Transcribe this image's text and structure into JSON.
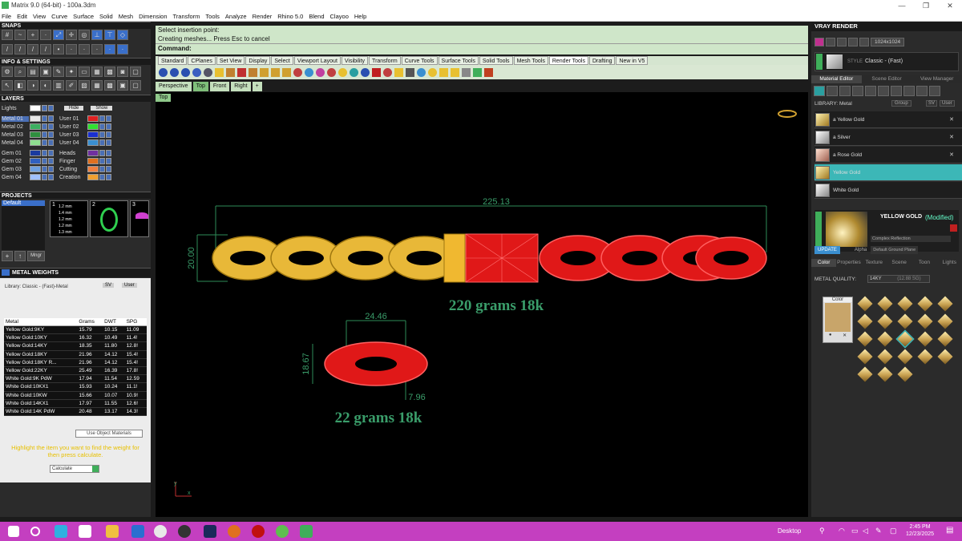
{
  "window": {
    "title": "Matrix 9.0 (64-bit) - 100a.3dm",
    "min": "—",
    "max": "❐",
    "close": "✕"
  },
  "menu": [
    "File",
    "Edit",
    "View",
    "Curve",
    "Surface",
    "Solid",
    "Mesh",
    "Dimension",
    "Transform",
    "Tools",
    "Analyze",
    "Render",
    "Rhino 5.0",
    "Blend",
    "Clayoo",
    "Help"
  ],
  "left": {
    "snaps": "SNAPS",
    "info": "INFO & SETTINGS",
    "layers": "LAYERS",
    "lights": "Lights",
    "hide": "Hide",
    "show": "Show",
    "layer_rows": [
      {
        "a": "Metal 01",
        "ac": "#e8e8e8",
        "b": "User 01",
        "bc": "#e02020"
      },
      {
        "a": "Metal 02",
        "ac": "#3cb060",
        "b": "User 02",
        "bc": "#30e030"
      },
      {
        "a": "Metal 03",
        "ac": "#2f8f3f",
        "b": "User 03",
        "bc": "#1a2fd0"
      },
      {
        "a": "Metal 04",
        "ac": "#8fe090",
        "b": "User 04",
        "bc": "#3a8fd0"
      },
      {
        "a": "Gem 01",
        "ac": "#1a3aa0",
        "b": "Heads",
        "bc": "#7030a0"
      },
      {
        "a": "Gem 02",
        "ac": "#3060c0",
        "b": "Finger",
        "bc": "#e07020"
      },
      {
        "a": "Gem 03",
        "ac": "#6fa0e0",
        "b": "Cutting",
        "bc": "#f08040"
      },
      {
        "a": "Gem 04",
        "ac": "#a0c0ff",
        "b": "Creation",
        "bc": "#f0a030"
      }
    ],
    "projects": "PROJECTS",
    "project_default": "Default",
    "thumb_nums": [
      "1",
      "2",
      "3"
    ],
    "thumb_gems": [
      "1.2 mm",
      "1.4 mm",
      "1.2 mm",
      "1.2 mm",
      "1.3 mm"
    ],
    "mngr": "Mngr",
    "weights_title": "METAL WEIGHTS",
    "library": "Library: Classic - (Fast)-Metal",
    "sv": "SV",
    "user": "User",
    "table_headers": [
      "Metal",
      "Grams",
      "DWT",
      "SPG"
    ],
    "table_rows": [
      [
        "Yellow Gold:9KY",
        "15.79",
        "10.15",
        "11.09"
      ],
      [
        "Yellow Gold:10KY",
        "16.32",
        "10.49",
        "11.4!"
      ],
      [
        "Yellow Gold:14KY",
        "18.35",
        "11.80",
        "12.8!"
      ],
      [
        "Yellow Gold:18KY",
        "21.96",
        "14.12",
        "15.4!"
      ],
      [
        "Yellow Gold:18KY R...",
        "21.96",
        "14.12",
        "15.4!"
      ],
      [
        "Yellow Gold:22KY",
        "25.49",
        "16.39",
        "17.8!"
      ],
      [
        "White Gold:9K PdW",
        "17.94",
        "11.54",
        "12.59"
      ],
      [
        "White Gold:10KX1",
        "15.93",
        "10.24",
        "11.1!"
      ],
      [
        "White Gold:10KW",
        "15.66",
        "10.07",
        "10.9!"
      ],
      [
        "White Gold:14KX1",
        "17.97",
        "11.55",
        "12.6!"
      ],
      [
        "White Gold:14K PdW",
        "20.48",
        "13.17",
        "14.3!"
      ]
    ],
    "use_obj": "Use Object Materials",
    "hint": "Highlight the item you want to find the weight for then press calculate.",
    "calculate": "Calculate"
  },
  "command": {
    "line1": "Select insertion point:",
    "line2": "Creating meshes... Press Esc to cancel",
    "label": "Command:"
  },
  "tabs": [
    "Standard",
    "CPlanes",
    "Set View",
    "Display",
    "Select",
    "Viewport Layout",
    "Visibility",
    "Transform",
    "Curve Tools",
    "Surface Tools",
    "Solid Tools",
    "Mesh Tools",
    "Render Tools",
    "Drafting",
    "New in V5"
  ],
  "active_tab": 12,
  "viewport_tabs": [
    "Perspective",
    "Top",
    "Front",
    "Right",
    "+"
  ],
  "active_viewport": 1,
  "viewport_label": "Top",
  "drawing": {
    "chain_width": "225.13",
    "chain_height": "20.00",
    "chain_text": "220 grams 18k",
    "link_width": "24.46",
    "link_height": "18.67",
    "link_thick": "7.96",
    "link_text": "22 grams 18k",
    "axis_y": "y",
    "axis_x": "x",
    "gold": "#e8b838",
    "red": "#e01818",
    "dim_color": "#2e8b57",
    "label_color": "#3a9d6a"
  },
  "right": {
    "vray": "VRAY RENDER",
    "resolution": "1024x1024",
    "style_label": "STYLE",
    "style_value": "Classic - (Fast)",
    "tabs": [
      "Material Editor",
      "Scene Editor",
      "View Manager"
    ],
    "library": "LIBRARY: Metal",
    "group": "Group",
    "sv": "SV",
    "user": "User",
    "materials": [
      "a Yellow Gold",
      "a Silver",
      "a Rose Gold",
      "Yellow Gold",
      "White Gold"
    ],
    "selected_material": 3,
    "mat_name": "YELLOW GOLD",
    "modified": "(Modified)",
    "complex": "Complex Reflection",
    "alpha": "Alpha",
    "ground": "Default Ground Plane",
    "update": "UPDATE",
    "bottom_tabs": [
      "Color",
      "Properties",
      "Texture",
      "Scene",
      "Toon",
      "Lights"
    ],
    "quality_label": "METAL QUALITY:",
    "quality_value": "14KY",
    "quality_extra": "(12.88 SG)",
    "color_label": "Color",
    "swatch": "#c8a56a"
  },
  "taskbar": {
    "desktop": "Desktop",
    "time": "2:45 PM",
    "date": "12/23/2025"
  }
}
